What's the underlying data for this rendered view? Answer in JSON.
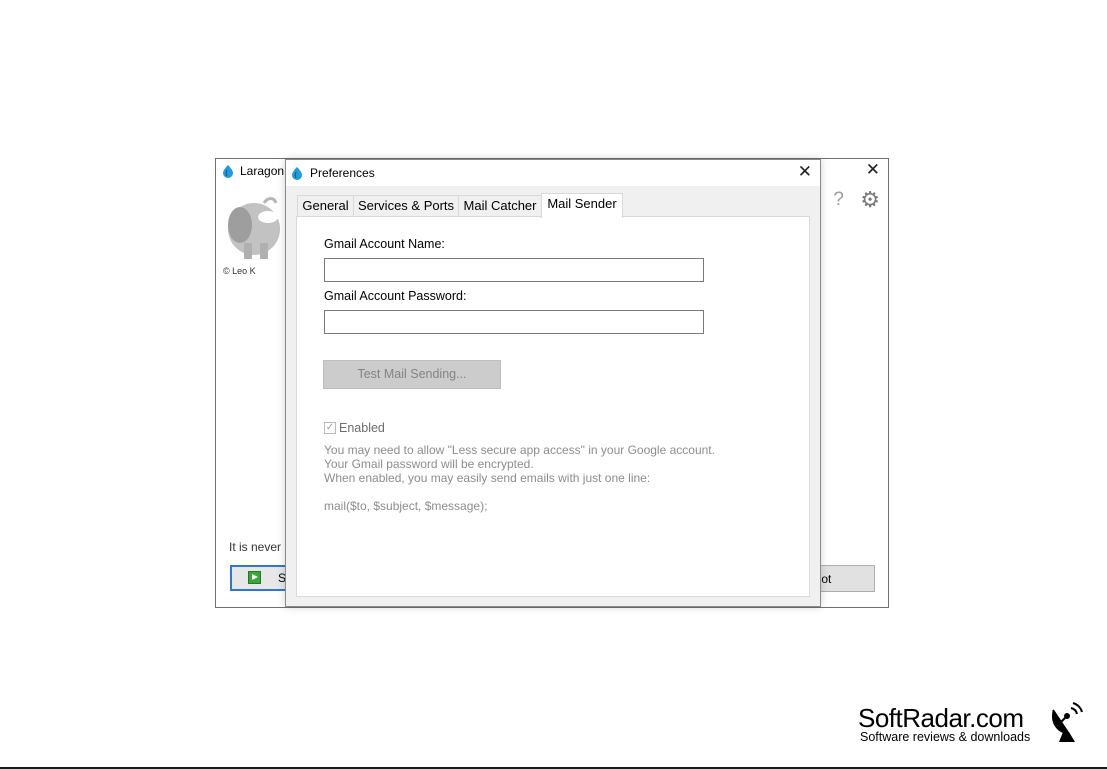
{
  "main_window": {
    "title": "Laragon",
    "copyright": "© Leo K",
    "tagline": "It is never",
    "start_button_label": "S",
    "root_button_label": "Root",
    "help_label": "?",
    "icons": [
      "laragon-drop-icon",
      "close-icon",
      "help-icon",
      "gear-icon",
      "elephant-logo",
      "play-icon"
    ]
  },
  "preferences": {
    "title": "Preferences",
    "tabs": [
      {
        "label": "General",
        "active": false
      },
      {
        "label": "Services & Ports",
        "active": false
      },
      {
        "label": "Mail Catcher",
        "active": false
      },
      {
        "label": "Mail Sender",
        "active": true
      }
    ],
    "mail_sender": {
      "account_name_label": "Gmail Account Name:",
      "account_name_value": "",
      "password_label": "Gmail Account Password:",
      "password_value": "",
      "test_button_label": "Test Mail Sending...",
      "enabled_label": "Enabled",
      "enabled_checked": true,
      "notes": [
        "You may need to allow \"Less secure app access\" in your Google account.",
        "Your Gmail password will be encrypted.",
        "When enabled, you may easily send emails with just one line:",
        "mail($to, $subject, $message);"
      ]
    }
  },
  "watermark": {
    "brand": "SoftRadar.com",
    "tagline": "Software reviews & downloads"
  },
  "colors": {
    "accent_blue": "#2b79d3",
    "drop_blue": "#1f9be0",
    "play_green": "#3aa63a",
    "disabled_text": "#8d8d8d"
  }
}
